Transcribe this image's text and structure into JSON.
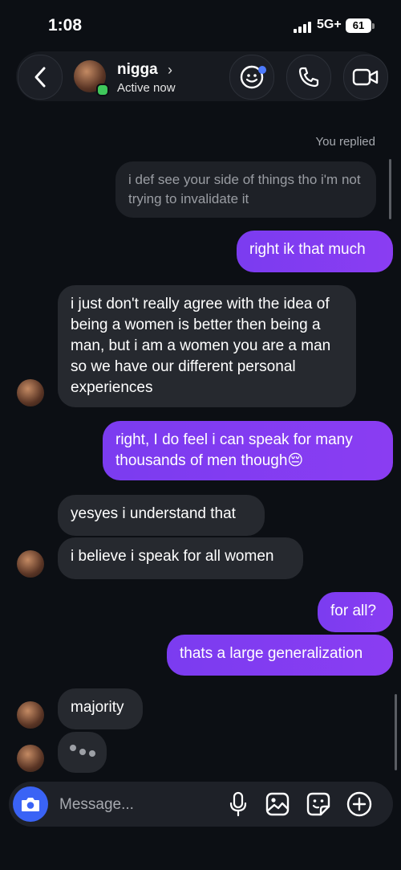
{
  "status_bar": {
    "time": "1:08",
    "network": "5G+",
    "battery": "61"
  },
  "header": {
    "name": "nigga",
    "chevron": "›",
    "status": "Active now"
  },
  "thread": {
    "replied_label": "You replied",
    "reply_preview": "i def see your side of things tho i'm not trying to invalidate it",
    "messages": [
      {
        "from": "me",
        "text": "right ik that much"
      },
      {
        "from": "them",
        "text": "i just don't really agree with the idea of being a women is better then being a man, but i am a women you are a man so we have our different personal experiences"
      },
      {
        "from": "me",
        "text": "right, I do feel i can speak for many thousands of men though😔"
      },
      {
        "from": "them",
        "text": "yesyes i understand that"
      },
      {
        "from": "them",
        "text": "i believe i speak for all women"
      },
      {
        "from": "me",
        "text": "for all?"
      },
      {
        "from": "me",
        "text": "thats a large generalization"
      },
      {
        "from": "them",
        "text": "majority"
      }
    ]
  },
  "composer": {
    "placeholder": "Message..."
  },
  "colors": {
    "background": "#0c0f14",
    "outgoing_bubble": "#7b3cf0",
    "incoming_bubble": "#26292f",
    "camera_button": "#3a63f5",
    "online": "#3fc85b"
  },
  "icons": [
    "back-icon",
    "sticker-effects-icon",
    "phone-icon",
    "video-camera-icon",
    "camera-icon",
    "microphone-icon",
    "gallery-icon",
    "sticker-icon",
    "plus-icon"
  ]
}
